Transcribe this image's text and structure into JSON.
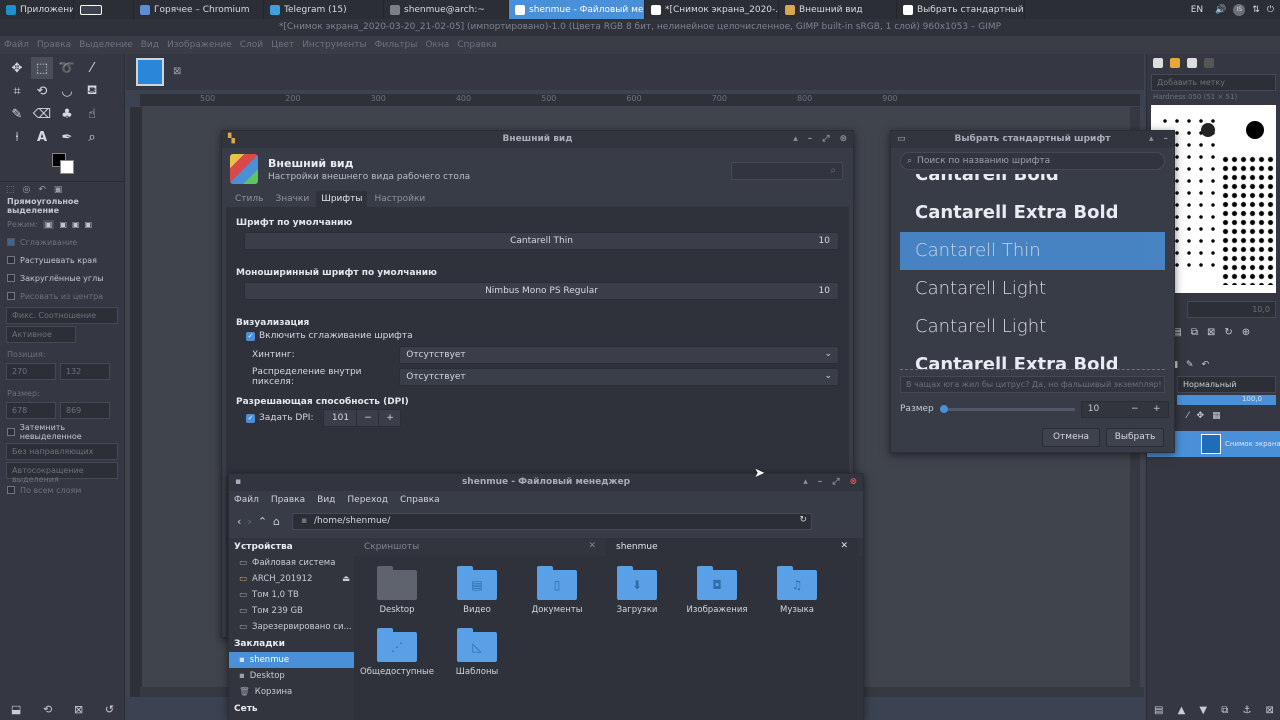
{
  "panel": {
    "apps_label": "Приложения",
    "tasks": [
      {
        "label": "Горячее – Chromium",
        "color": "#5a8fd6"
      },
      {
        "label": "Telegram (15)",
        "color": "#3aa0de"
      },
      {
        "label": "shenmue@arch:~",
        "color": "#7a7f8a"
      },
      {
        "label": "shenmue - Файловый ме...",
        "color": "#ffffff",
        "active": true
      },
      {
        "label": "*[Снимок экрана_2020-...",
        "color": "#ffffff"
      },
      {
        "label": "Внешний вид",
        "color": "#d8a84a"
      },
      {
        "label": "Выбрать стандартный ш...",
        "color": "#ffffff"
      }
    ],
    "lang": "EN",
    "tray_badge": "IS"
  },
  "gimp": {
    "title": "*[Снимок экрана_2020-03-20_21-02-05] (импортировано)-1.0 (Цвета RGB 8 бит, нелинейное целочисленное, GIMP built-in sRGB, 1 слой) 960x1053 – GIMP",
    "menu": [
      "Файл",
      "Правка",
      "Выделение",
      "Вид",
      "Изображение",
      "Слой",
      "Цвет",
      "Инструменты",
      "Фильтры",
      "Окна",
      "Справка"
    ],
    "ruler_ticks": [
      "500",
      "200",
      "300",
      "400",
      "500",
      "600",
      "700",
      "800",
      "900"
    ],
    "tool_options": {
      "title": "Прямоугольное выделение",
      "mode_label": "Режим:",
      "smoothing": "Сглаживание",
      "feather": "Растушевать края",
      "rounded": "Закруглённые углы",
      "from_center": "Рисовать из центра",
      "fixed": "Фикс. Соотношение",
      "active": "Активное",
      "position_label": "Позиция:",
      "pos_unit": "px",
      "pos_x": "270",
      "pos_y": "132",
      "size_label": "Размер:",
      "size_unit": "px",
      "size_w": "678",
      "size_h": "869",
      "darken": "Затемнить невыделенное",
      "guides": "Без направляющих",
      "autoshrink": "Автосокращение выделения",
      "all_layers": "По всем слоям"
    },
    "brushes": {
      "filter": "Добавить метку",
      "hardness": "Hardness 050 (51 × 51)"
    },
    "layers": {
      "mode": "Нормальный",
      "opacity": "100,0",
      "layer_name": "Снимок экрана"
    },
    "spacing": "10,0",
    "zoom_unit": "px"
  },
  "appearance": {
    "window_title": "Внешний вид",
    "heading": "Внешний вид",
    "subheading": "Настройки внешнего вида рабочего стола",
    "tabs": [
      "Стиль",
      "Значки",
      "Шрифты",
      "Настройки"
    ],
    "active_tab": "Шрифты",
    "default_font_label": "Шрифт по умолчанию",
    "default_font": "Cantarell Thin",
    "default_font_size": "10",
    "mono_font_label": "Моноширинный шрифт по умолчанию",
    "mono_font": "Nimbus Mono PS Regular",
    "mono_font_size": "10",
    "render_label": "Визуализация",
    "antialias_label": "Включить сглаживание шрифта",
    "hinting_label": "Хинтинг:",
    "hinting_value": "Отсутствует",
    "subpixel_label": "Распределение внутри пикселя:",
    "subpixel_value": "Отсутствует",
    "dpi_section": "Разрешающая способность (DPI)",
    "dpi_label": "Задать DPI:",
    "dpi_value": "101",
    "dpi_minus": "−",
    "dpi_plus": "+"
  },
  "fontchooser": {
    "window_title": "Выбрать стандартный шрифт",
    "search_placeholder": "Поиск по названию шрифта",
    "fonts": [
      {
        "label": "Cantarell Bold",
        "weight": "bold"
      },
      {
        "label": "Cantarell Extra Bold",
        "weight": "bold"
      },
      {
        "label": "Cantarell Thin",
        "weight": "200",
        "selected": true
      },
      {
        "label": "Cantarell Light",
        "weight": "300"
      },
      {
        "label": "Cantarell Light",
        "weight": "300"
      },
      {
        "label": "Cantarell Extra Bold",
        "weight": "bold"
      }
    ],
    "preview_text": "В чащах юга жил бы цитрус? Да, но фальшивый экземпляр!",
    "size_label": "Размер",
    "size_value": "10",
    "cancel": "Отмена",
    "select": "Выбрать"
  },
  "filemanager": {
    "window_title": "shenmue - Файловый менеджер",
    "menu": [
      "Файл",
      "Правка",
      "Вид",
      "Переход",
      "Справка"
    ],
    "path": "/home/shenmue/",
    "devices_header": "Устройства",
    "devices": [
      "Файловая система",
      "ARCH_201912",
      "Том 1,0 TB",
      "Том 239 GB",
      "Зарезервировано си..."
    ],
    "bookmarks_header": "Закладки",
    "bookmarks": [
      "shenmue",
      "Desktop",
      "Корзина"
    ],
    "network_header": "Сеть",
    "tabs": [
      "Скриншоты",
      "shenmue"
    ],
    "folders": [
      {
        "label": "Desktop",
        "icon": "desktop-folder-icon"
      },
      {
        "label": "Видео",
        "icon": "video-folder-icon"
      },
      {
        "label": "Документы",
        "icon": "documents-folder-icon"
      },
      {
        "label": "Загрузки",
        "icon": "downloads-folder-icon"
      },
      {
        "label": "Изображения",
        "icon": "pictures-folder-icon"
      },
      {
        "label": "Музыка",
        "icon": "music-folder-icon"
      },
      {
        "label": "Общедоступные",
        "icon": "public-folder-icon"
      },
      {
        "label": "Шаблоны",
        "icon": "templates-folder-icon"
      }
    ]
  },
  "colors": {
    "accent": "#4a90d9",
    "panel_bg": "#2b2e35",
    "window_bg": "#383c46",
    "folder": "#5aa0e6",
    "close_red": "#e0505a"
  }
}
